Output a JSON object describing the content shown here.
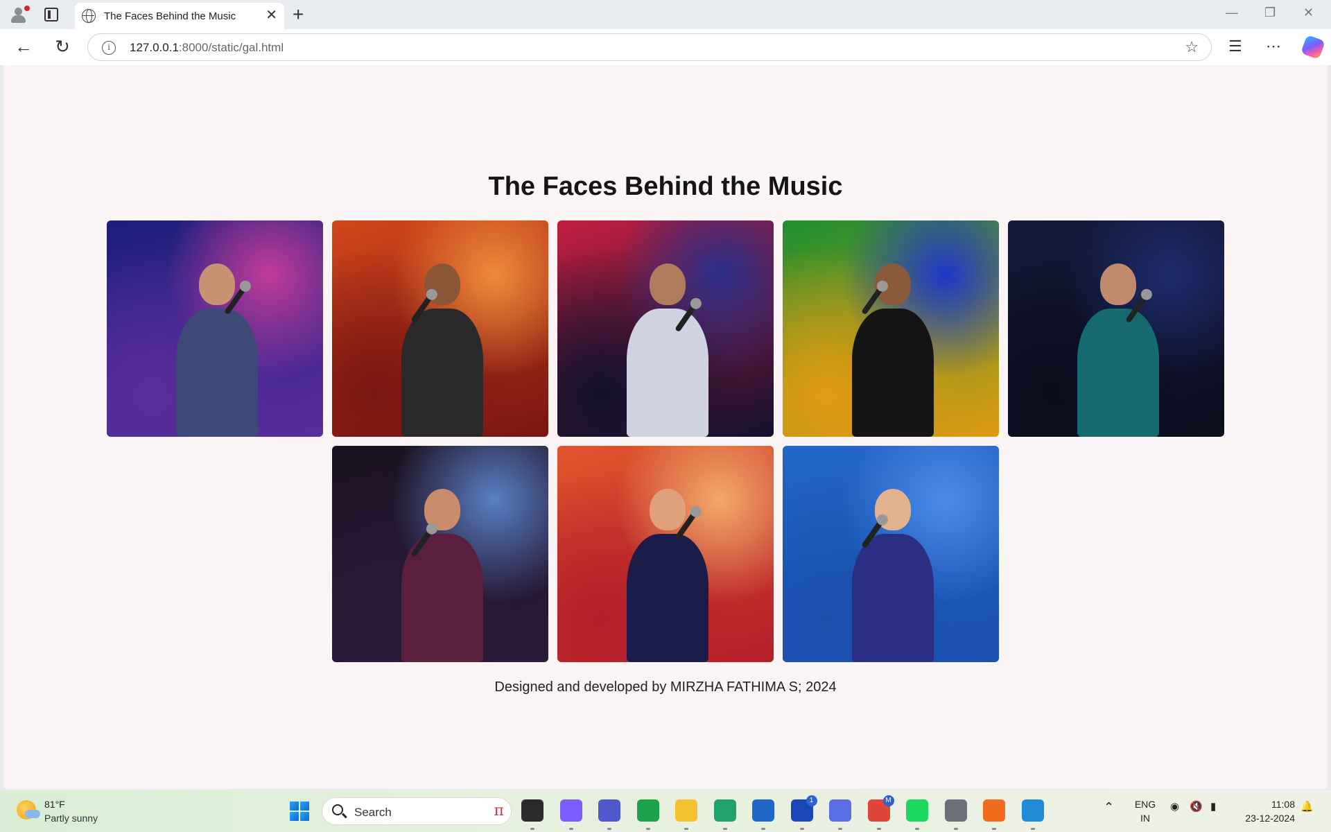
{
  "browser": {
    "tab_title": "The Faces Behind the Music",
    "new_tab_symbol": "+",
    "close_symbol": "✕",
    "url_host": "127.0.0.1",
    "url_path": ":8000/static/gal.html",
    "window_controls": {
      "minimize": "—",
      "restore": "❐",
      "close": "✕"
    },
    "icons": [
      "back-arrow-icon",
      "refresh-icon",
      "info-icon",
      "star-icon",
      "favorites-icon",
      "more-icon",
      "copilot-icon"
    ]
  },
  "page": {
    "title": "The Faces Behind the Music",
    "footer": "Designed and developed by MIRZHA FATHIMA S; 2024",
    "photos": [
      {
        "name": "photo-1",
        "bg": [
          "#1c1f7a",
          "#5a2d9c",
          "#c23b9a"
        ],
        "skin": "#c99273",
        "outfit": "#3d4a78"
      },
      {
        "name": "photo-2",
        "bg": [
          "#d1461b",
          "#7a1512",
          "#f08a3a"
        ],
        "skin": "#8a5636",
        "outfit": "#2a2a2a"
      },
      {
        "name": "photo-3",
        "bg": [
          "#c21e3f",
          "#12112e",
          "#2b2f8a"
        ],
        "skin": "#b07a5c",
        "outfit": "#cfd2e0"
      },
      {
        "name": "photo-4",
        "bg": [
          "#1d8f2f",
          "#e29b12",
          "#1f36c9"
        ],
        "skin": "#8b5a3a",
        "outfit": "#151515"
      },
      {
        "name": "photo-5",
        "bg": [
          "#141a3a",
          "#0b0d1e",
          "#1e2c6e"
        ],
        "skin": "#c28a6c",
        "outfit": "#156a6e"
      },
      {
        "name": "photo-6",
        "bg": [
          "#1b1220",
          "#2a1a3a",
          "#5a7fc6"
        ],
        "skin": "#c98d6c",
        "outfit": "#5a1f3e"
      },
      {
        "name": "photo-7",
        "bg": [
          "#e0552c",
          "#b21e2a",
          "#f2a96c"
        ],
        "skin": "#e0a07a",
        "outfit": "#1a1d4a"
      },
      {
        "name": "photo-8",
        "bg": [
          "#2266c9",
          "#1a4fae",
          "#4a8be8"
        ],
        "skin": "#e2b28f",
        "outfit": "#2b2f84"
      }
    ]
  },
  "taskbar": {
    "weather_temp": "81°F",
    "weather_cond": "Partly sunny",
    "search_label": "Search",
    "lang_1": "ENG",
    "lang_2": "IN",
    "time": "11:08",
    "date": "23-12-2024",
    "apps": [
      {
        "name": "file-explorer-dark-icon",
        "color": "#2b2b2b"
      },
      {
        "name": "copilot-app-icon",
        "color": "#7a5cff"
      },
      {
        "name": "teams-icon",
        "color": "#5059c9"
      },
      {
        "name": "refresh-ring-icon",
        "color": "#1aa34a"
      },
      {
        "name": "folder-icon",
        "color": "#f2c230"
      },
      {
        "name": "edge-icon",
        "color": "#1fa36b"
      },
      {
        "name": "store-icon",
        "color": "#2167c9"
      },
      {
        "name": "l-app-icon",
        "color": "#1a46b8",
        "badge": "1"
      },
      {
        "name": "arc-app-icon",
        "color": "#5a6ee6"
      },
      {
        "name": "chrome-icon",
        "color": "#e0453a",
        "badge": "M"
      },
      {
        "name": "spotify-icon",
        "color": "#1ed760"
      },
      {
        "name": "settings-icon",
        "color": "#6b7079"
      },
      {
        "name": "fus-app-icon",
        "color": "#f26a1b"
      },
      {
        "name": "vscode-icon",
        "color": "#1f8ad6"
      }
    ]
  }
}
